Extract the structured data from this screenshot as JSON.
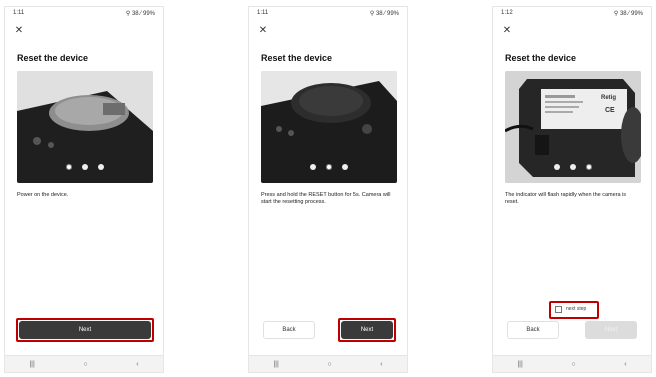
{
  "colors": {
    "highlight": "#c00000",
    "primary_button": "#3a3a3a",
    "disabled_button": "#dcdcdc"
  },
  "screens": [
    {
      "status": {
        "time": "1:11",
        "right": "⚲ 38 ⁄ 99%"
      },
      "title": "Reset the device",
      "description": "Power on the device.",
      "buttons": {
        "next": "Next"
      }
    },
    {
      "status": {
        "time": "1:11",
        "right": "⚲ 38 ⁄ 99%"
      },
      "title": "Reset the device",
      "description": "Press and hold the RESET button for 5s. Camera will start the resetting process.",
      "buttons": {
        "back": "Back",
        "next": "Next"
      }
    },
    {
      "status": {
        "time": "1:12",
        "right": "⚲ 38 ⁄ 99%"
      },
      "title": "Reset the device",
      "description": "The indicator will flash rapidly when the camera is reset.",
      "checkbox_label": "next step",
      "buttons": {
        "back": "Back",
        "next": "Next"
      },
      "device_labels": {
        "brand": "Retig",
        "mark": "CE"
      }
    }
  ],
  "navbar": {
    "recent": "|||",
    "home": "○",
    "back": "‹"
  }
}
